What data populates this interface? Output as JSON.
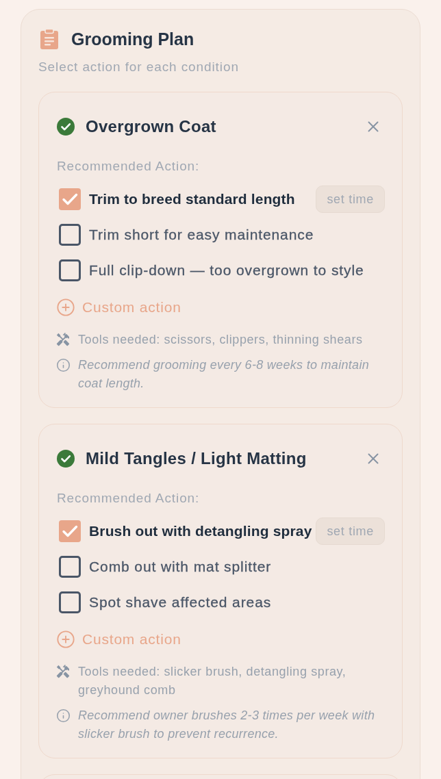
{
  "header": {
    "title": "Grooming Plan",
    "subtitle": "Select action for each condition"
  },
  "conditions": [
    {
      "title": "Overgrown Coat",
      "done": true,
      "section_label": "Recommended Action:",
      "options": [
        {
          "label": "Trim to breed standard length",
          "checked": true,
          "button": "set time"
        },
        {
          "label": "Trim short for easy maintenance",
          "checked": false
        },
        {
          "label": "Full clip-down — too overgrown to style",
          "checked": false
        }
      ],
      "custom_action": "Custom action",
      "tools": "Tools needed: scissors, clippers, thinning shears",
      "note": "Recommend grooming every 6-8 weeks to maintain coat length."
    },
    {
      "title": "Mild Tangles / Light Matting",
      "done": true,
      "section_label": "Recommended Action:",
      "options": [
        {
          "label": "Brush out with detangling spray",
          "checked": true,
          "button": "set time"
        },
        {
          "label": "Comb out with mat splitter",
          "checked": false
        },
        {
          "label": "Spot shave affected areas",
          "checked": false
        }
      ],
      "custom_action": "Custom action",
      "tools": "Tools needed: slicker brush, detangling spray, greyhound comb",
      "note": "Recommend owner brushes 2-3 times per week with slicker brush to prevent recurrence."
    }
  ]
}
